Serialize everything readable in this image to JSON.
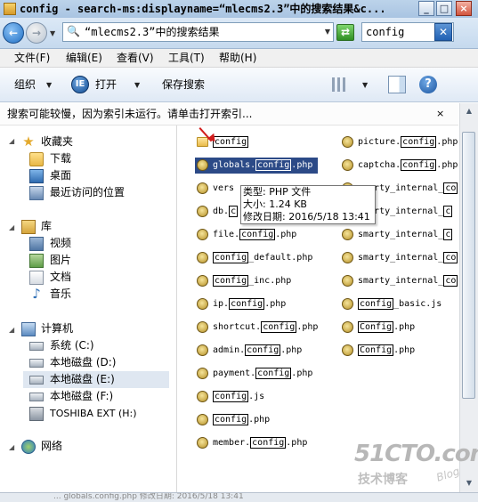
{
  "window": {
    "title": "config - search-ms:displayname=“mlecms2.3”中的搜索结果&c..."
  },
  "address": {
    "path": "“mlecms2.3”中的搜索结果",
    "search_value": "config"
  },
  "menu": [
    "文件(F)",
    "编辑(E)",
    "查看(V)",
    "工具(T)",
    "帮助(H)"
  ],
  "toolbar": {
    "organize": "组织",
    "open": "打开",
    "save_search": "保存搜索"
  },
  "infobar": {
    "text": "搜索可能较慢，因为索引未运行。请单击打开索引...",
    "close": "×"
  },
  "nav": {
    "favorites": "收藏夹",
    "downloads": "下载",
    "desktop": "桌面",
    "recent": "最近访问的位置",
    "libraries": "库",
    "videos": "视频",
    "pictures": "图片",
    "documents": "文档",
    "music": "音乐",
    "computer": "计算机",
    "drive_c": "系统 (C:)",
    "drive_d": "本地磁盘 (D:)",
    "drive_e": "本地磁盘 (E:)",
    "drive_f": "本地磁盘 (F:)",
    "drive_h": "TOSHIBA EXT (H:)",
    "network": "网络"
  },
  "files_left": [
    {
      "pre": "",
      "hl": "config",
      "post": "",
      "type": "folder"
    },
    {
      "pre": "globals.",
      "hl": "config",
      "post": ".php",
      "type": "php",
      "selected": true
    },
    {
      "pre": "vers",
      "hl": "",
      "post": "",
      "type": "php"
    },
    {
      "pre": "db.",
      "hl": "c",
      "post": "",
      "type": "php"
    },
    {
      "pre": "file.",
      "hl": "config",
      "post": ".php",
      "type": "php"
    },
    {
      "pre": "",
      "hl": "config",
      "post": "_default.php",
      "type": "php"
    },
    {
      "pre": "",
      "hl": "config",
      "post": "_inc.php",
      "type": "php"
    },
    {
      "pre": "ip.",
      "hl": "config",
      "post": ".php",
      "type": "php"
    },
    {
      "pre": "shortcut.",
      "hl": "config",
      "post": ".php",
      "type": "php"
    },
    {
      "pre": "admin.",
      "hl": "config",
      "post": ".php",
      "type": "php"
    },
    {
      "pre": "payment.",
      "hl": "config",
      "post": ".php",
      "type": "php"
    },
    {
      "pre": "",
      "hl": "config",
      "post": ".js",
      "type": "php"
    },
    {
      "pre": "",
      "hl": "config",
      "post": ".php",
      "type": "php"
    },
    {
      "pre": "member.",
      "hl": "config",
      "post": ".php",
      "type": "php"
    }
  ],
  "files_right": [
    {
      "pre": "picture.",
      "hl": "config",
      "post": ".php"
    },
    {
      "pre": "captcha.",
      "hl": "config",
      "post": ".php"
    },
    {
      "pre": "smarty_internal_",
      "hl": "co",
      "post": ""
    },
    {
      "pre": "smarty_internal_",
      "hl": "c",
      "post": ""
    },
    {
      "pre": "smarty_internal_",
      "hl": "c",
      "post": ""
    },
    {
      "pre": "smarty_internal_",
      "hl": "co",
      "post": ""
    },
    {
      "pre": "smarty_internal_",
      "hl": "co",
      "post": ""
    },
    {
      "pre": "",
      "hl": "config",
      "post": "_basic.js"
    },
    {
      "pre": "",
      "hl": "Config",
      "post": ".php"
    },
    {
      "pre": "",
      "hl": "Config",
      "post": ".php"
    }
  ],
  "tooltip": {
    "type": "类型: PHP 文件",
    "size": "大小: 1.24 KB",
    "modified": "修改日期: 2016/5/18 13:41"
  },
  "statusbar": {
    "text": "... globals.config.php  修改日期: 2016/5/18 13:41"
  },
  "watermark": {
    "main": "51CTO.com",
    "sub": "技术博客",
    "blog": "Blog"
  }
}
